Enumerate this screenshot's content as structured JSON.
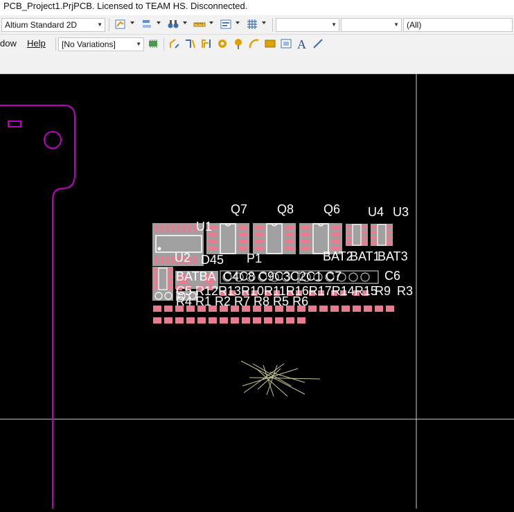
{
  "window": {
    "title": "PCB_Project1.PrjPCB. Licensed to TEAM HS. Disconnected."
  },
  "toolbar": {
    "view_mode": "Altium Standard 2D",
    "combo_empty_1": "",
    "combo_empty_2": "",
    "combo_all": "(All)"
  },
  "menu": {
    "window_partial": "dow",
    "help": "Help"
  },
  "variations": {
    "selected": "[No Variations]"
  },
  "designators": {
    "q7": "Q7",
    "q8": "Q8",
    "q6": "Q6",
    "u4": "U4",
    "u3": "U3",
    "u1": "U1",
    "u2": "U2",
    "d45": "D45",
    "p1": "P1",
    "bat2": "BAT2",
    "bat1": "BAT1",
    "bat3": "BAT3",
    "batba": "BATBA",
    "c6": "C6",
    "row_c": "C5 R12R13R10R11R16R17R14R15",
    "r9": "R9",
    "r3": "R3",
    "row_r": "R4 R1 R2 R7 R8 R5 R6",
    "cap_row": "C4C8 C9C3C2C1 C7"
  },
  "colors": {
    "board_outline": "#c000c0",
    "pad": "#e87c8e",
    "silk": "#ffffff",
    "ratsnest": "#c8c890",
    "grid": "#d0d0d0"
  }
}
